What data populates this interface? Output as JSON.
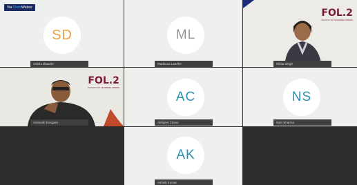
{
  "app": {
    "brand_prefix": "Via",
    "brand_accent": "Cisco",
    "brand_suffix": "Webex"
  },
  "tiles": [
    {
      "initials": "SD",
      "name": "sakshi dhawde"
    },
    {
      "initials": "ML",
      "name": "Madhuca Landhe"
    },
    {
      "initials": "",
      "name": "Nikita Singh",
      "video": true
    },
    {
      "initials": "",
      "name": "Animesh Dongare",
      "video": true
    },
    {
      "initials": "AC",
      "name": "Abhijeet Chavu"
    },
    {
      "initials": "NS",
      "name": "Nitin Sharma"
    },
    {
      "initials": "AK",
      "name": "Ashish Kumar"
    }
  ],
  "logo": {
    "text": "FOL.2",
    "subtitle": "FACULTY OF LEARNING SERIES"
  },
  "colors": {
    "tile_bg": "#eef0ee",
    "dark_bg": "#2e2e2e",
    "name_tag": "#3f3f3f",
    "brand_bg": "#1a2a5e",
    "accent": "#7a1a3a"
  }
}
